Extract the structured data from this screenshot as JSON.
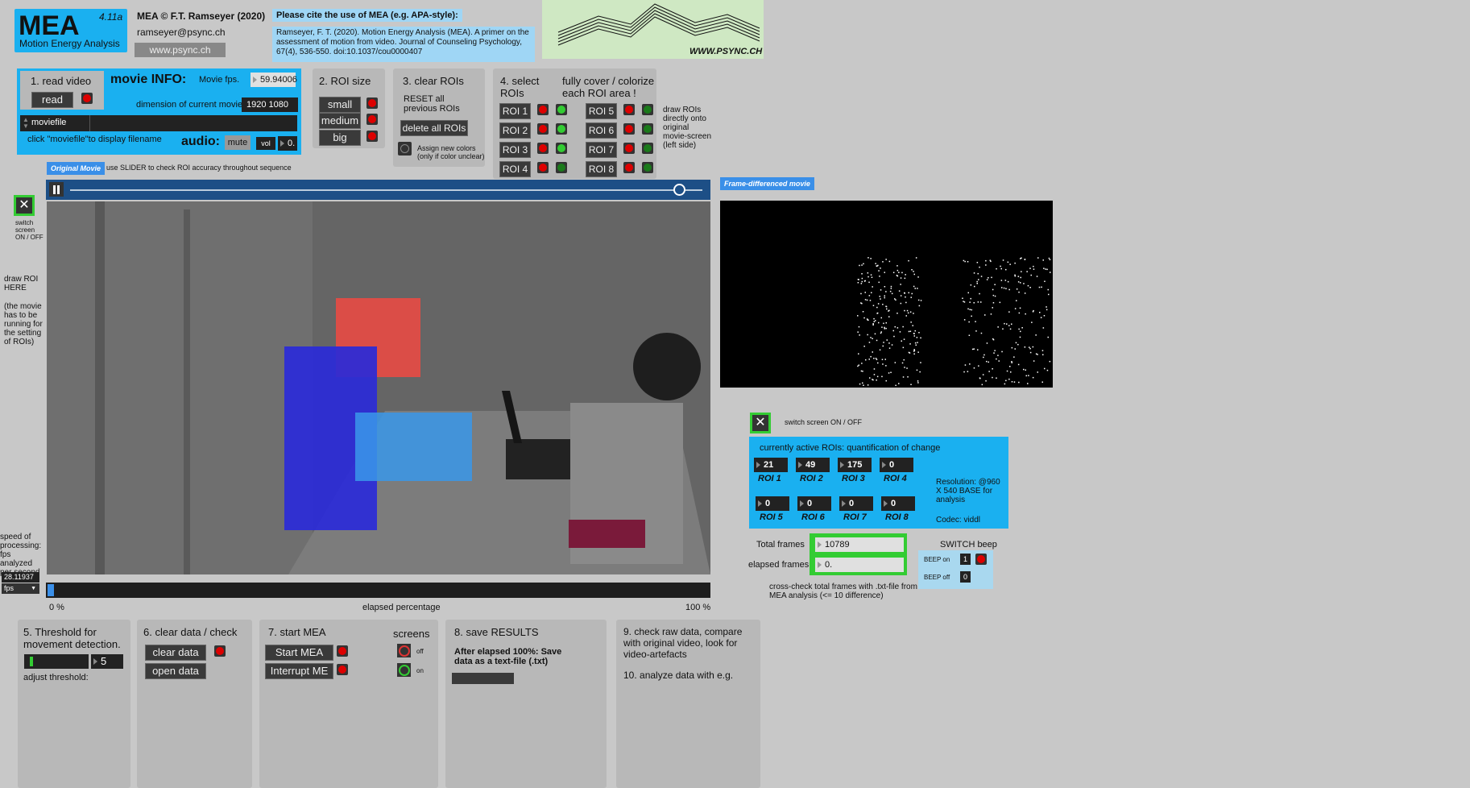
{
  "header": {
    "logo_title": "MEA",
    "version": "4.11a",
    "logo_subtitle": "Motion Energy Analysis",
    "copyright": "MEA © F.T. Ramseyer (2020)",
    "email": "ramseyer@psync.ch",
    "website": "www.psync.ch",
    "cite_heading": "Please cite the use of MEA (e.g. APA-style):",
    "citation": "Ramseyer, F. T. (2020). Motion Energy Analysis (MEA). A primer on the assessment of motion from video. Journal of Counseling Psychology, 67(4), 536-550. doi:10.1037/cou0000407",
    "banner_text": "WWW.PSYNC.CH"
  },
  "step1": {
    "title": "1. read video",
    "read_label": "read",
    "movie_info": "movie INFO:",
    "fps_label": "Movie fps.",
    "fps_value": "59.94006",
    "dim_label": "dimension of current movie",
    "dim_value": "1920 1080",
    "file_value": "moviefile",
    "hint": "click \"moviefile\"to display  filename",
    "audio_label": "audio:",
    "mute_label": "mute",
    "vol_label": "vol",
    "vol_value": "0."
  },
  "step2": {
    "title": "2. ROI size",
    "small": "small",
    "medium": "medium",
    "big": "big"
  },
  "step3": {
    "title": "3. clear ROIs",
    "reset_text": "RESET all previous ROIs",
    "delete_label": "delete all ROIs",
    "assign_text": "Assign new colors (only if color unclear)"
  },
  "step4": {
    "title": "4. select ROIs",
    "cover_text": "fully cover / colorize each ROI area !",
    "rois": [
      "ROI 1",
      "ROI 2",
      "ROI 3",
      "ROI 4",
      "ROI 5",
      "ROI 6",
      "ROI 7",
      "ROI 8"
    ],
    "side_note": "draw ROIs directly onto original movie-screen (left side)"
  },
  "left_panel": {
    "switch_text": "switch screen ON / OFF",
    "draw_roi": "draw ROI HERE",
    "draw_note": "(the movie has to be running for the setting of ROIs)",
    "speed_text": "speed of processing: fps analyzed per second",
    "speed_value": "28.11937",
    "fps_unit": "fps"
  },
  "movie": {
    "original_tag": "Original Movie",
    "slider_hint": "use SLIDER to check ROI accuracy throughout sequence",
    "progress_start": "0 %",
    "progress_mid": "elapsed percentage",
    "progress_end": "100 %",
    "progress_fraction": 0.01
  },
  "diff": {
    "tag": "Frame-differenced movie",
    "switch_text": "switch screen ON / OFF",
    "quant_title": "currently active ROIs: quantification of change",
    "roi_values": [
      {
        "value": "21",
        "label": "ROI 1"
      },
      {
        "value": "49",
        "label": "ROI 2"
      },
      {
        "value": "175",
        "label": "ROI 3"
      },
      {
        "value": "0",
        "label": "ROI 4"
      },
      {
        "value": "0",
        "label": "ROI 5"
      },
      {
        "value": "0",
        "label": "ROI 6"
      },
      {
        "value": "0",
        "label": "ROI 7"
      },
      {
        "value": "0",
        "label": "ROI 8"
      }
    ],
    "resolution": "Resolution: @960 X 540 BASE for analysis",
    "codec": "Codec: viddl",
    "total_label": "Total frames",
    "total_value": "10789",
    "elapsed_label": "elapsed frames",
    "elapsed_value": "0.",
    "crosscheck": "cross-check total frames with .txt-file from MEA analysis (<= 10 difference)",
    "beep_title": "SWITCH beep",
    "beep_on": "BEEP  on",
    "beep_on_val": "1",
    "beep_off": "BEEP  off",
    "beep_off_val": "0"
  },
  "bottom": {
    "step5": "5. Threshold for movement detection.",
    "threshold": "5",
    "adjust": "adjust threshold:",
    "step6": "6. clear data / check",
    "clear_label": "clear data",
    "open_label": "open data",
    "step7": "7. start MEA",
    "screens": "screens",
    "start_label": "Start MEA",
    "interrupt_label": "Interrupt ME",
    "off": "off",
    "on": "on",
    "step8": "8. save RESULTS",
    "save_text": "After elapsed 100%: Save data as a text-file (.txt)",
    "step9": "9. check raw data, compare with original video, look for video-artefacts",
    "step10": "10. analyze data with e.g."
  }
}
